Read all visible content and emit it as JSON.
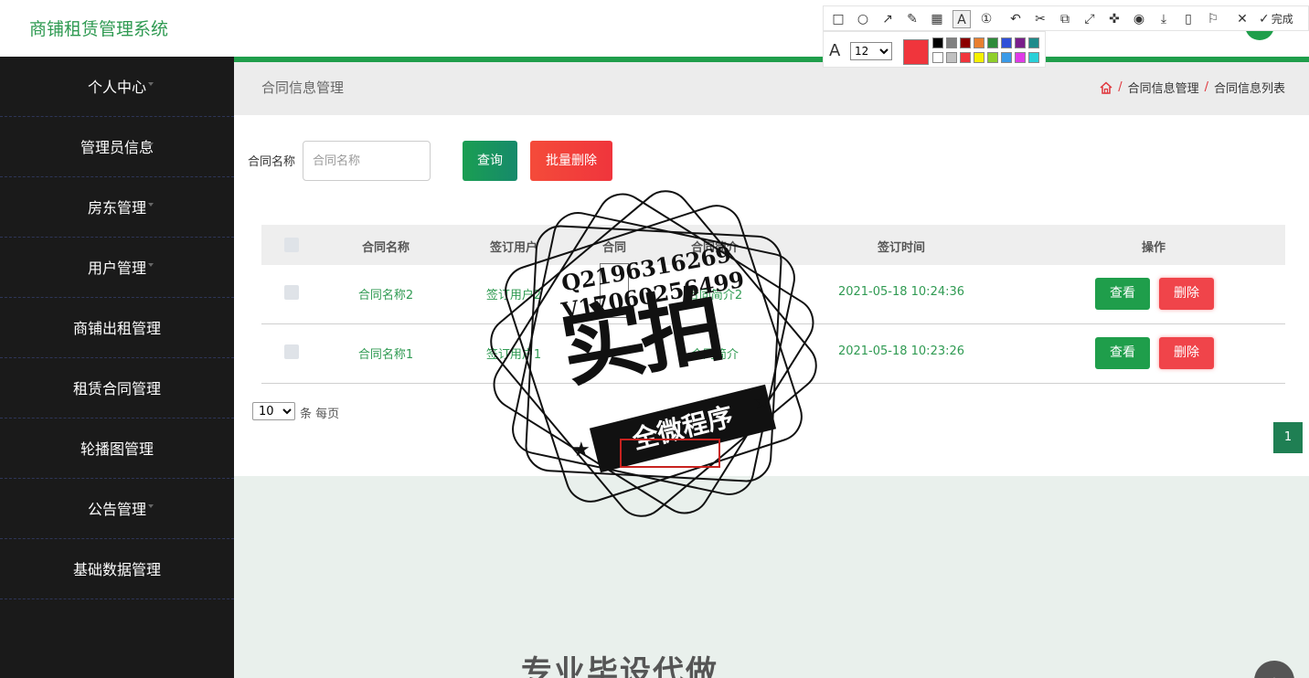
{
  "app_title": "商铺租赁管理系统",
  "sidebar": {
    "items": [
      {
        "label": "个人中心"
      },
      {
        "label": "管理员信息"
      },
      {
        "label": "房东管理"
      },
      {
        "label": "用户管理"
      },
      {
        "label": "商铺出租管理"
      },
      {
        "label": "租赁合同管理"
      },
      {
        "label": "轮播图管理"
      },
      {
        "label": "公告管理"
      },
      {
        "label": "基础数据管理"
      }
    ]
  },
  "page": {
    "title": "合同信息管理",
    "breadcrumb": [
      "合同信息管理",
      "合同信息列表"
    ]
  },
  "search": {
    "label": "合同名称",
    "placeholder": "合同名称",
    "query_button": "查询",
    "batch_delete_button": "批量删除"
  },
  "table": {
    "headers": [
      "合同名称",
      "签订用户",
      "合同",
      "合同简介",
      "签订时间",
      "操作"
    ],
    "rows": [
      {
        "name": "合同名称2",
        "user": "签订用户2",
        "intro": "合同简介2",
        "time": "2021-05-18 10:24:36"
      },
      {
        "name": "合同名称1",
        "user": "签订用户1",
        "intro": "合同简介",
        "time": "2021-05-18 10:23:26"
      }
    ],
    "view_button": "查看",
    "delete_button": "删除"
  },
  "pagination": {
    "page_size": "10",
    "page_size_suffix": "条 每页",
    "current_page": "1"
  },
  "toolbar": {
    "done_label": "完成",
    "font_size": "12",
    "current_color": "#f0353c",
    "swatches": [
      "#000000",
      "#808080",
      "#8b0000",
      "#e87f2f",
      "#2f8b3a",
      "#2f4fd8",
      "#7a1f8b",
      "#1f8b8b",
      "#ffffff",
      "#c0c0c0",
      "#f0353c",
      "#f5f000",
      "#8fcf2a",
      "#3a9ae8",
      "#e03ae8",
      "#2ad0d8"
    ]
  },
  "watermark": {
    "line1": "Q2196316269",
    "line2": "V17060256499",
    "big": "实拍",
    "banner": "全微程序"
  },
  "bottom_text": "专业毕设代做",
  "colors": {
    "accent": "#1f9e4b",
    "danger": "#f0444a",
    "sidebar_bg": "#1a1a1a"
  }
}
